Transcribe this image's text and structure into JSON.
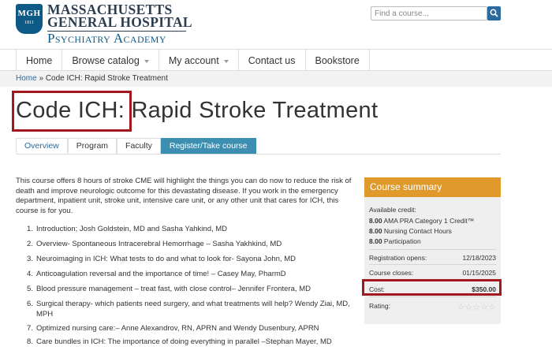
{
  "header": {
    "seal_text": "MGH",
    "seal_year": "1811",
    "org_line1": "MASSACHUSETTS",
    "org_line2": "GENERAL HOSPITAL",
    "academy": "Psychiatry Academy",
    "search_placeholder": "Find a course..."
  },
  "nav": {
    "items": [
      "Home",
      "Browse catalog",
      "My account",
      "Contact us",
      "Bookstore"
    ]
  },
  "breadcrumb": {
    "home": "Home",
    "separator": " » ",
    "current": "Code ICH: Rapid Stroke Treatment"
  },
  "page": {
    "title": "Code ICH: Rapid Stroke Treatment"
  },
  "tabs": [
    "Overview",
    "Program",
    "Faculty",
    "Register/Take course"
  ],
  "description": "This course offers 8 hours of stroke CME will highlight the things you can do now to reduce the risk of death and improve neurologic outcome for this devastating disease. If you work in the emergency department, inpatient unit, stroke unit, intensive care unit, or any other unit that cares for ICH, this course is for you.",
  "program": [
    {
      "num": "1.",
      "text": "Introduction; Josh Goldstein, MD and Sasha Yahkind, MD"
    },
    {
      "num": "2.",
      "text": "Overview- Spontaneous Intracerebral Hemorrhage – Sasha Yakhkind, MD"
    },
    {
      "num": "3.",
      "text": "Neuroimaging in ICH: What tests to do and what to look for- Sayona John, MD"
    },
    {
      "num": "4.",
      "text": "Anticoagulation reversal and the importance of time! – Casey May, PharmD"
    },
    {
      "num": "5.",
      "text": "Blood pressure management – treat fast, with close control– Jennifer Frontera, MD"
    },
    {
      "num": "6.",
      "text": "Surgical therapy- which patients need surgery, and what treatments will help?  Wendy Ziai, MD, MPH"
    },
    {
      "num": "7.",
      "text": "Optimized nursing care:– Anne Alexandrov, RN, APRN and Wendy Dusenbury, APRN"
    },
    {
      "num": "8.",
      "text": "Care bundles in ICH: The importance of doing everything in parallel –Stephan Mayer, MD"
    }
  ],
  "summary": {
    "heading": "Course summary",
    "credit_label": "Available credit:",
    "credits": [
      {
        "amount": "8.00",
        "type": "AMA PRA Category 1 Credit™"
      },
      {
        "amount": "8.00",
        "type": "Nursing Contact Hours"
      },
      {
        "amount": "8.00",
        "type": "Participation"
      }
    ],
    "registration_opens_label": "Registration opens:",
    "registration_opens": "12/18/2023",
    "course_closes_label": "Course closes:",
    "course_closes": "01/15/2025",
    "cost_label": "Cost:",
    "cost": "$350.00",
    "rating_label": "Rating:",
    "rating": 0,
    "rating_max": 5
  },
  "colors": {
    "brand_blue": "#2a6a9e",
    "summary_orange": "#e09a2c",
    "highlight_red": "#a3181e",
    "cta_blue": "#3c8fb0"
  }
}
